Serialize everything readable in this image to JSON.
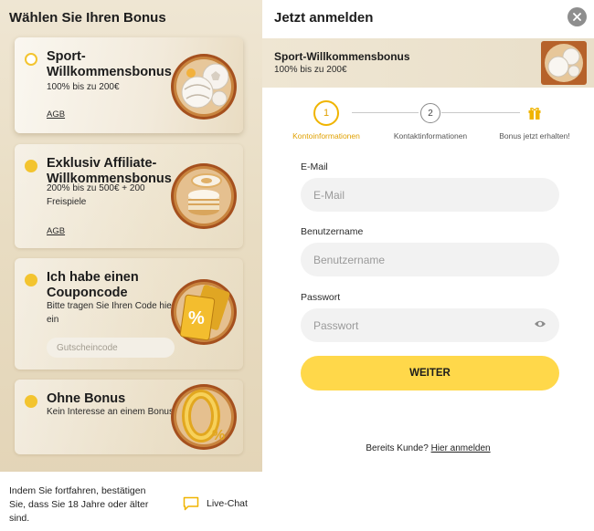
{
  "left": {
    "title": "Wählen Sie Ihren Bonus",
    "options": [
      {
        "title": "Sport-Willkommensbonus",
        "desc": "100% bis zu 200€",
        "link": "AGB",
        "selected": true
      },
      {
        "title": "Exklusiv Affiliate-Willkommensbonus",
        "desc": "200% bis zu 500€ + 200 Freispiele",
        "link": "AGB",
        "selected": false
      },
      {
        "title": "Ich habe einen Couponcode",
        "desc": "Bitte tragen Sie Ihren Code hier ein",
        "input_placeholder": "Gutscheincode",
        "selected": false
      },
      {
        "title": "Ohne Bonus",
        "desc": "Kein Interesse an einem Bonus",
        "selected": false
      }
    ],
    "footer": {
      "text": "Indem Sie fortfahren, bestätigen Sie, dass Sie 18 Jahre oder älter sind.",
      "livechat": "Live-Chat"
    }
  },
  "right": {
    "title": "Jetzt anmelden",
    "banner": {
      "title": "Sport-Willkommensbonus",
      "subtitle": "100% bis zu 200€"
    },
    "steps": [
      {
        "num": "1",
        "label": "Kontoinformationen",
        "active": true
      },
      {
        "num": "2",
        "label": "Kontaktinformationen",
        "active": false
      },
      {
        "num": "",
        "label": "Bonus jetzt erhalten!",
        "active": false,
        "icon": "gift-icon"
      }
    ],
    "fields": {
      "email": {
        "label": "E-Mail",
        "placeholder": "E-Mail"
      },
      "username": {
        "label": "Benutzername",
        "placeholder": "Benutzername"
      },
      "password": {
        "label": "Passwort",
        "placeholder": "Passwort"
      }
    },
    "submit": "WEITER",
    "login": {
      "prefix": "Bereits Kunde?",
      "link": "Hier anmelden"
    }
  },
  "colors": {
    "accent": "#ffd84a",
    "radio": "#f3c42f",
    "step_active": "#f0b400",
    "panel_bg": "#e8dcc2"
  },
  "icons": [
    "football-icon",
    "casino-chips-icon",
    "coupon-icon",
    "zero-percent-icon",
    "close-icon",
    "eye-icon",
    "chat-icon",
    "gift-icon"
  ]
}
